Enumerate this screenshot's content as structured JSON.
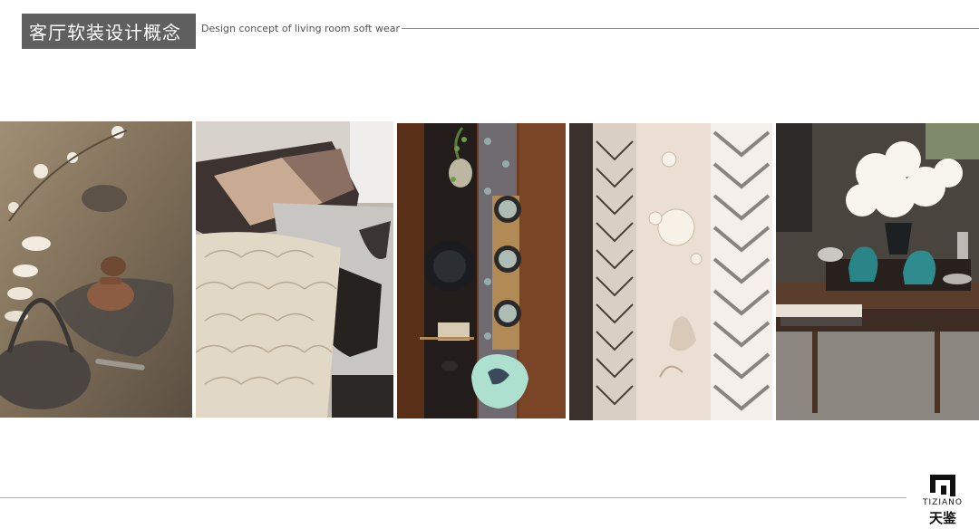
{
  "header": {
    "title": "客厅软装设计概念",
    "subtitle": "Design concept of living room soft wear"
  },
  "gallery": [
    {
      "subject": "tea-set",
      "palette": {
        "bg": "#8a7a63",
        "accent": "#c9b99a"
      }
    },
    {
      "subject": "cushions",
      "palette": {
        "bg": "#3a3230",
        "accent": "#e8d9c4"
      }
    },
    {
      "subject": "table-setting",
      "palette": {
        "bg": "#6b3e22",
        "accent": "#7aa8a0"
      }
    },
    {
      "subject": "curtain-fabrics",
      "palette": {
        "bg": "#e9ddd0",
        "accent": "#5a4a40"
      }
    },
    {
      "subject": "coffee-table-decor",
      "palette": {
        "bg": "#3b3531",
        "accent": "#2f8a8a"
      }
    }
  ],
  "logo": {
    "brand_latin": "TIZIANO",
    "brand_cn": "天鉴"
  },
  "colors": {
    "title_bg": "#5f5f5f",
    "title_fg": "#ffffff",
    "subtitle": "#555555",
    "rule": "#8a8a8a"
  }
}
